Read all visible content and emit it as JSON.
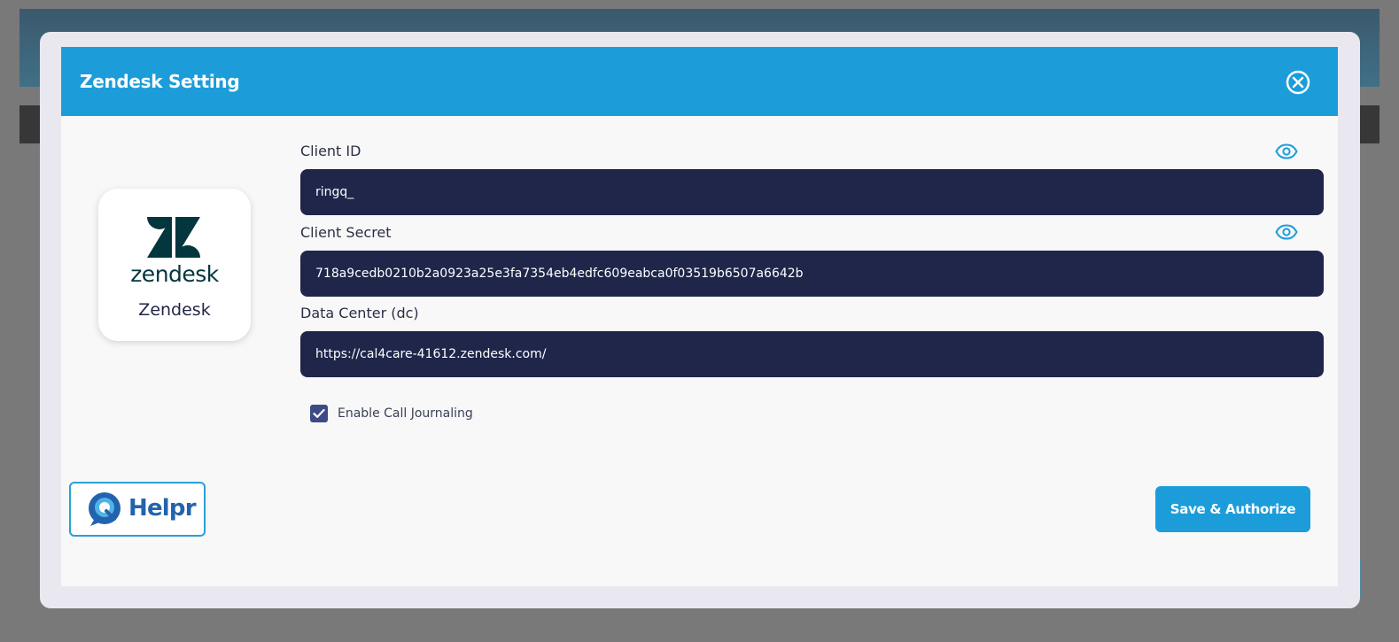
{
  "modal": {
    "title": "Zendesk Setting"
  },
  "integration": {
    "logo_wordmark": "zendesk",
    "name": "Zendesk"
  },
  "fields": {
    "client_id": {
      "label": "Client ID",
      "value": "ringq_"
    },
    "client_secret": {
      "label": "Client Secret",
      "value": "718a9cedb0210b2a0923a25e3fa7354eb4edfc609eabca0f03519b6507a6642b"
    },
    "data_center": {
      "label": "Data Center (dc)",
      "value": "https://cal4care-41612.zendesk.com/"
    }
  },
  "call_journaling": {
    "label": "Enable Call Journaling",
    "checked": true
  },
  "branding": {
    "helpr_text": "Helpr"
  },
  "actions": {
    "save_label": "Save & Authorize"
  },
  "colors": {
    "header": "#1c9dda",
    "input_bg": "#1f264a",
    "checkbox": "#3e4a86",
    "zendesk_brand": "#03363d"
  },
  "icons": {
    "close": "close-circle-icon",
    "eye": "eye-icon",
    "check": "checkmark-icon"
  }
}
